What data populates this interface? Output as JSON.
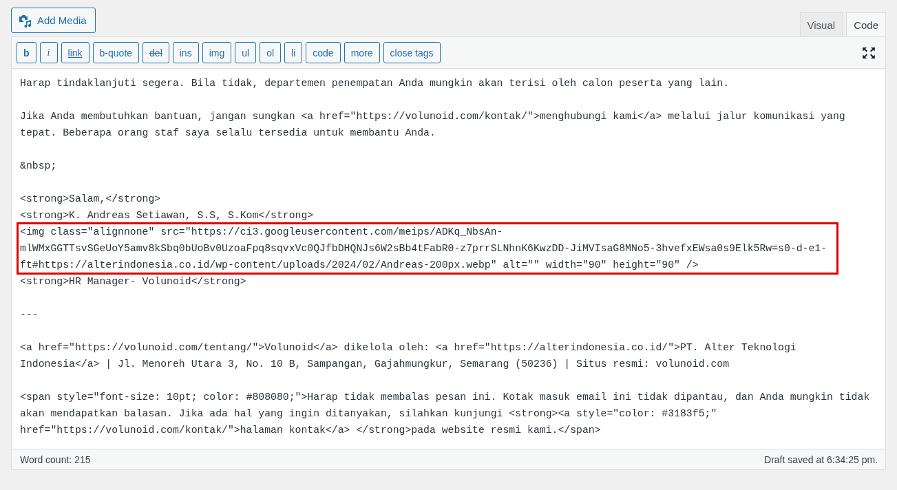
{
  "add_media": {
    "label": "Add Media"
  },
  "tabs": [
    {
      "label": "Visual",
      "selected": false
    },
    {
      "label": "Code",
      "selected": true
    }
  ],
  "toolbar": [
    {
      "label": "b",
      "kind": "bold"
    },
    {
      "label": "i",
      "kind": "italic"
    },
    {
      "label": "link",
      "kind": "link"
    },
    {
      "label": "b-quote",
      "kind": "plain"
    },
    {
      "label": "del",
      "kind": "strike"
    },
    {
      "label": "ins",
      "kind": "plain"
    },
    {
      "label": "img",
      "kind": "plain"
    },
    {
      "label": "ul",
      "kind": "plain"
    },
    {
      "label": "ol",
      "kind": "plain"
    },
    {
      "label": "li",
      "kind": "plain"
    },
    {
      "label": "code",
      "kind": "plain"
    },
    {
      "label": "more",
      "kind": "plain"
    },
    {
      "label": "close tags",
      "kind": "plain"
    }
  ],
  "paragraphs": [
    {
      "parts": [
        {
          "highlighted": false,
          "lines": [
            "Harap tindaklanjuti segera. Bila tidak, departemen penempatan Anda mungkin akan terisi oleh calon peserta yang lain."
          ]
        }
      ]
    },
    {
      "parts": [
        {
          "highlighted": false,
          "lines": [
            "Jika Anda membutuhkan bantuan, jangan sungkan <a href=\"https://volunoid.com/kontak/\">menghubungi kami</a> melalui jalur komunikasi yang",
            "tepat. Beberapa orang staf saya selalu tersedia untuk membantu Anda."
          ]
        }
      ]
    },
    {
      "parts": [
        {
          "highlighted": false,
          "lines": [
            "&nbsp;"
          ]
        }
      ]
    },
    {
      "parts": [
        {
          "highlighted": false,
          "lines": [
            "<strong>Salam,</strong>",
            "<strong>K. Andreas Setiawan, S.S, S.Kom</strong>"
          ]
        },
        {
          "highlighted": true,
          "lines": [
            "<img class=\"alignnone\" src=\"https://ci3.googleusercontent.com/meips/ADKq_NbsAn-",
            "mlWMxGGTTsvSGeUoY5amv8kSbq0bUoBv0UzoaFpq8sqvxVc0QJfbDHQNJs6W2sBb4tFabR0-z7prrSLNhnK6KwzDD-JiMVIsaG8MNo5-3hvefxEWsa0s9Elk5Rw=s0-d-e1-",
            "ft#https://alterindonesia.co.id/wp-content/uploads/2024/02/Andreas-200px.webp\" alt=\"\" width=\"90\" height=\"90\" />"
          ]
        },
        {
          "highlighted": false,
          "lines": [
            "<strong>HR Manager- Volunoid</strong>"
          ]
        }
      ]
    },
    {
      "parts": [
        {
          "highlighted": false,
          "lines": [
            "---"
          ]
        }
      ]
    },
    {
      "parts": [
        {
          "highlighted": false,
          "lines": [
            "<a href=\"https://volunoid.com/tentang/\">Volunoid</a> dikelola oleh: <a href=\"https://alterindonesia.co.id/\">PT. Alter Teknologi",
            "Indonesia</a> | Jl. Menoreh Utara 3, No. 10 B, Sampangan, Gajahmungkur, Semarang (50236) | Situs resmi: volunoid.com"
          ]
        }
      ]
    },
    {
      "parts": [
        {
          "highlighted": false,
          "lines": [
            "<span style=\"font-size: 10pt; color: #808080;\">Harap tidak membalas pesan ini. Kotak masuk email ini tidak dipantau, dan Anda mungkin tidak",
            "akan mendapatkan balasan. Jika ada hal yang ingin ditanyakan, silahkan kunjungi <strong><a style=\"color: #3183f5;\"",
            "href=\"https://volunoid.com/kontak/\">halaman kontak</a> </strong>pada website resmi kami.</span>"
          ]
        }
      ]
    }
  ],
  "status_bar": {
    "word_count": "Word count: 215",
    "draft_status": "Draft saved at 6:34:25 pm."
  }
}
